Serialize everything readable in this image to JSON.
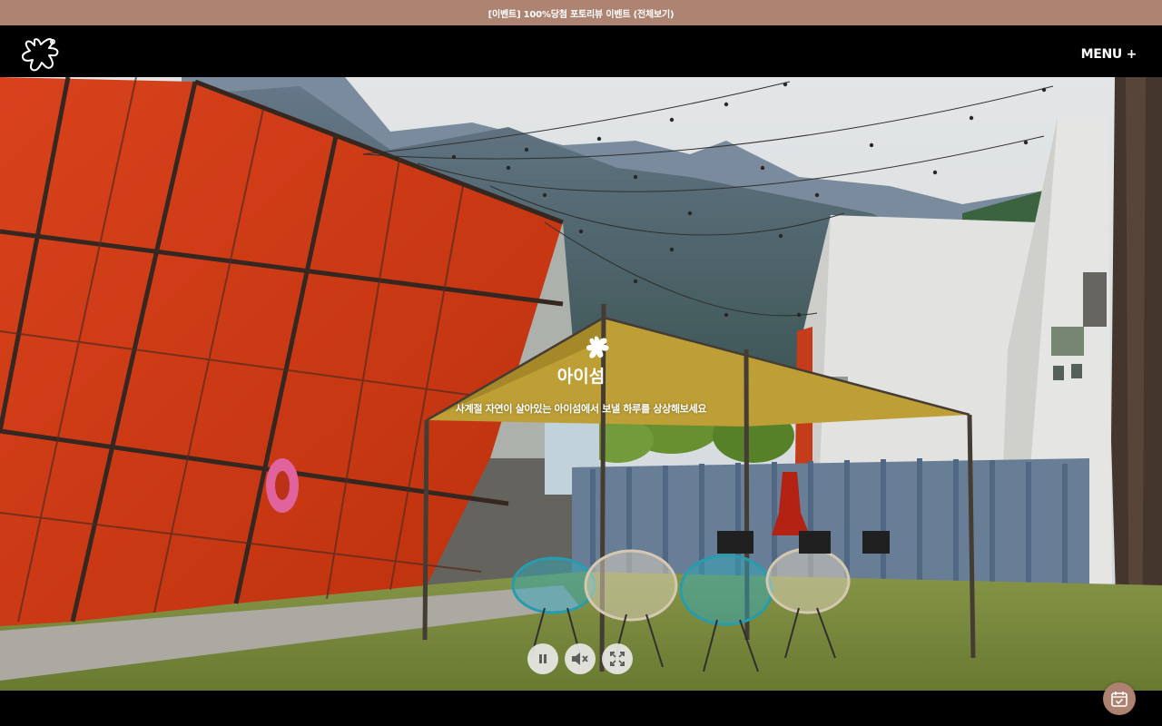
{
  "promo": {
    "text": "[이벤트] 100%당첨 포토리뷰 이벤트 (전체보기)"
  },
  "header": {
    "logo_icon": "star-splash-logo-icon",
    "menu_label": "MENU +"
  },
  "hero": {
    "brand_icon": "aiseom-brand-logo",
    "brand_name": "아이섬",
    "tagline": "사계절 자연이 살아있는 아이섬에서 보낼 하루를 상상해보세요"
  },
  "controls": {
    "pause_icon": "pause-icon",
    "mute_icon": "volume-mute-icon",
    "fullscreen_icon": "fullscreen-icon"
  },
  "floating": {
    "reserve_icon": "calendar-check-icon"
  },
  "colors": {
    "promo_bg": "#ad8372",
    "header_bg": "#000000",
    "accent": "#ae8270",
    "text_light": "#ffffff"
  }
}
